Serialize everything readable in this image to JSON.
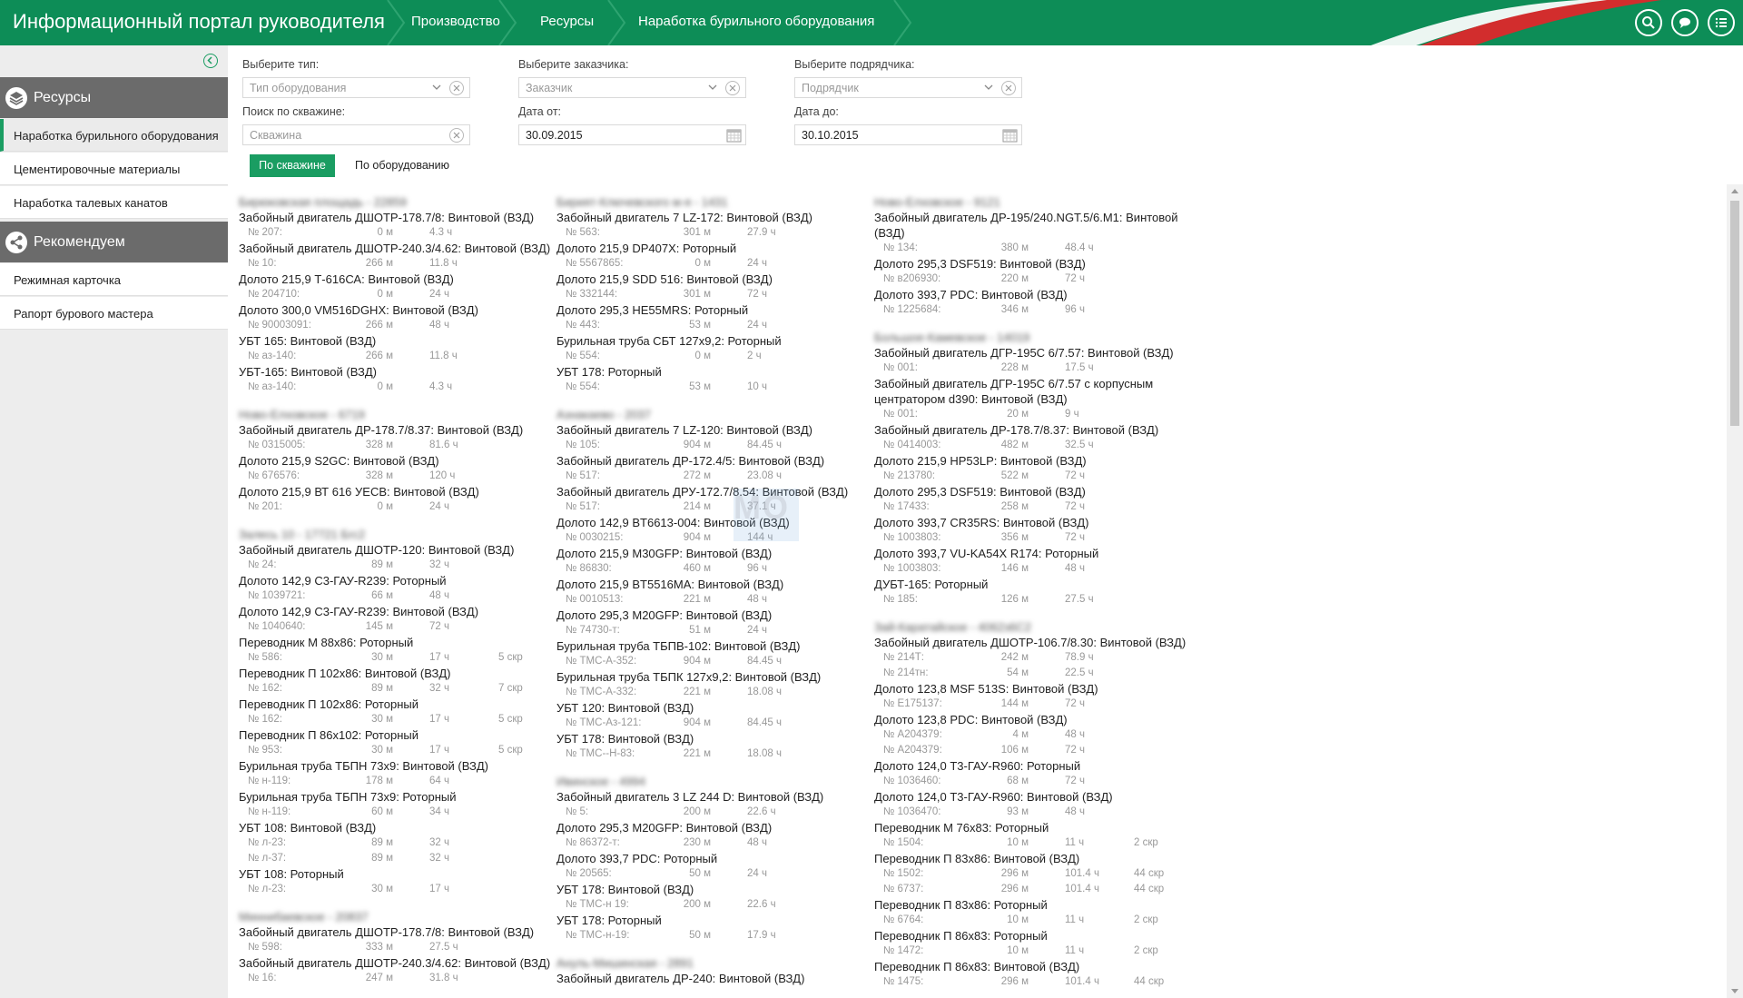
{
  "header": {
    "app_title": "Информационный портал руководителя",
    "breadcrumbs": [
      "Производство",
      "Ресурсы",
      "Наработка бурильного оборудования"
    ],
    "icons": [
      "search-icon",
      "chat-icon",
      "menu-icon"
    ]
  },
  "sidebar": {
    "sections": [
      {
        "title": "Ресурсы",
        "icon": "layers-icon",
        "items": [
          "Наработка бурильного оборудования",
          "Цементировочные материалы",
          "Наработка талевых канатов"
        ]
      },
      {
        "title": "Рекомендуем",
        "icon": "share-icon",
        "items": [
          "Режимная карточка",
          "Рапорт бурового мастера"
        ]
      }
    ],
    "active_item": "Наработка бурильного оборудования"
  },
  "filters": {
    "type_label": "Выберите тип:",
    "type_placeholder": "Тип оборудования",
    "customer_label": "Выберите заказчика:",
    "customer_placeholder": "Заказчик",
    "contractor_label": "Выберите подрядчика:",
    "contractor_placeholder": "Подрядчик",
    "well_search_label": "Поиск по скважине:",
    "well_search_placeholder": "Скважина",
    "date_from_label": "Дата от:",
    "date_from": "30.09.2015",
    "date_to_label": "Дата до:",
    "date_to": "30.10.2015"
  },
  "view_toggle": {
    "by_well": "По скважине",
    "by_equipment": "По оборудованию",
    "active": "По скважине"
  },
  "watermark": "MO",
  "columns": [
    [
      {
        "well": "Бирюковская площадь - 22859",
        "items": [
          {
            "name": "Забойный двигатель ДШОТР-178.7/8: Винтовой (ВЗД)",
            "rows": [
              [
                "№ 207:",
                "0 м",
                "4.3 ч",
                ""
              ]
            ]
          },
          {
            "name": "Забойный двигатель ДШОТР-240.3/4.62: Винтовой (ВЗД)",
            "rows": [
              [
                "№ 10:",
                "266 м",
                "11.8 ч",
                ""
              ]
            ]
          },
          {
            "name": "Долото 215,9 Т-616СА: Винтовой (ВЗД)",
            "rows": [
              [
                "№ 204710:",
                "0 м",
                "24 ч",
                ""
              ]
            ]
          },
          {
            "name": "Долото 300,0 VM516DGHX: Винтовой (ВЗД)",
            "rows": [
              [
                "№ 90003091:",
                "266 м",
                "48 ч",
                ""
              ]
            ]
          },
          {
            "name": "УБТ 165: Винтовой (ВЗД)",
            "rows": [
              [
                "№ аз-140:",
                "266 м",
                "11.8 ч",
                ""
              ]
            ]
          },
          {
            "name": "УБТ-165: Винтовой (ВЗД)",
            "rows": [
              [
                "№ аз-140:",
                "0 м",
                "4.3 ч",
                ""
              ]
            ]
          }
        ]
      },
      {
        "well": "Ново-Елховское - 6719",
        "items": [
          {
            "name": "Забойный двигатель ДР-178.7/8.37: Винтовой (ВЗД)",
            "rows": [
              [
                "№ 0315005:",
                "328 м",
                "81.6 ч",
                ""
              ]
            ]
          },
          {
            "name": "Долото 215,9 S2GC: Винтовой (ВЗД)",
            "rows": [
              [
                "№ 676576:",
                "328 м",
                "120 ч",
                ""
              ]
            ]
          },
          {
            "name": "Долото 215,9 ВТ 616 УЕСВ: Винтовой (ВЗД)",
            "rows": [
              [
                "№ 201:",
                "0 м",
                "24 ч",
                ""
              ]
            ]
          }
        ]
      },
      {
        "well": "Залесь 10 - 17721 Бгс2",
        "items": [
          {
            "name": "Забойный двигатель ДШОТР-120: Винтовой (ВЗД)",
            "rows": [
              [
                "№ 24:",
                "89 м",
                "32 ч",
                ""
              ]
            ]
          },
          {
            "name": "Долото 142,9 С3-ГАУ-R239: Роторный",
            "rows": [
              [
                "№ 1039721:",
                "66 м",
                "48 ч",
                ""
              ]
            ]
          },
          {
            "name": "Долото 142,9 С3-ГАУ-R239: Винтовой (ВЗД)",
            "rows": [
              [
                "№ 1040640:",
                "145 м",
                "72 ч",
                ""
              ]
            ]
          },
          {
            "name": "Переводник М 88х86: Роторный",
            "rows": [
              [
                "№ 586:",
                "30 м",
                "17 ч",
                "5 скр"
              ]
            ]
          },
          {
            "name": "Переводник П 102х86: Винтовой (ВЗД)",
            "rows": [
              [
                "№ 162:",
                "89 м",
                "32 ч",
                "7 скр"
              ]
            ]
          },
          {
            "name": "Переводник П 102х86: Роторный",
            "rows": [
              [
                "№ 162:",
                "30 м",
                "17 ч",
                "5 скр"
              ]
            ]
          },
          {
            "name": "Переводник П 86х102: Роторный",
            "rows": [
              [
                "№ 953:",
                "30 м",
                "17 ч",
                "5 скр"
              ]
            ]
          },
          {
            "name": "Бурильная труба ТБПН 73х9: Винтовой (ВЗД)",
            "rows": [
              [
                "№ н-119:",
                "178 м",
                "64 ч",
                ""
              ]
            ]
          },
          {
            "name": "Бурильная труба ТБПН 73х9: Роторный",
            "rows": [
              [
                "№ н-119:",
                "60 м",
                "34 ч",
                ""
              ]
            ]
          },
          {
            "name": "УБТ 108: Винтовой (ВЗД)",
            "rows": [
              [
                "№ л-23:",
                "89 м",
                "32 ч",
                ""
              ],
              [
                "№ л-37:",
                "89 м",
                "32 ч",
                ""
              ]
            ]
          },
          {
            "name": "УБТ 108: Роторный",
            "rows": [
              [
                "№ л-23:",
                "30 м",
                "17 ч",
                ""
              ]
            ]
          }
        ]
      },
      {
        "well": "Миннибаевское - 20837",
        "items": [
          {
            "name": "Забойный двигатель ДШОТР-178.7/8: Винтовой (ВЗД)",
            "rows": [
              [
                "№ 598:",
                "333 м",
                "27.5 ч",
                ""
              ]
            ]
          },
          {
            "name": "Забойный двигатель ДШОТР-240.3/4.62: Винтовой (ВЗД)",
            "rows": [
              [
                "№ 16:",
                "247 м",
                "31.8 ч",
                ""
              ]
            ]
          }
        ]
      }
    ],
    [
      {
        "well": "Бирият-Ключевского м-я - 1431",
        "items": [
          {
            "name": "Забойный двигатель 7 LZ-172: Винтовой (ВЗД)",
            "rows": [
              [
                "№ 563:",
                "301 м",
                "27.9 ч",
                ""
              ]
            ]
          },
          {
            "name": "Долото 215,9 DP407X: Роторный",
            "rows": [
              [
                "№ 5567865:",
                "0 м",
                "24 ч",
                ""
              ]
            ]
          },
          {
            "name": "Долото 215,9 SDD 516: Винтовой (ВЗД)",
            "rows": [
              [
                "№ 332144:",
                "301 м",
                "72 ч",
                ""
              ]
            ]
          },
          {
            "name": "Долото 295,3 НЕ55MRS: Роторный",
            "rows": [
              [
                "№ 443:",
                "53 м",
                "24 ч",
                ""
              ]
            ]
          },
          {
            "name": "Бурильная труба СБТ 127х9,2: Роторный",
            "rows": [
              [
                "№ 554:",
                "0 м",
                "2 ч",
                ""
              ]
            ]
          },
          {
            "name": "УБТ 178: Роторный",
            "rows": [
              [
                "№ 554:",
                "53 м",
                "10 ч",
                ""
              ]
            ]
          }
        ]
      },
      {
        "well": "Азнакаево - 2037",
        "items": [
          {
            "name": "Забойный двигатель 7 LZ-120: Винтовой (ВЗД)",
            "rows": [
              [
                "№ 105:",
                "904 м",
                "84.45 ч",
                ""
              ]
            ]
          },
          {
            "name": "Забойный двигатель ДР-172.4/5: Винтовой (ВЗД)",
            "rows": [
              [
                "№ 517:",
                "272 м",
                "23.08 ч",
                ""
              ]
            ]
          },
          {
            "name": "Забойный двигатель ДРУ-172.7/8.54: Винтовой (ВЗД)",
            "rows": [
              [
                "№ 517:",
                "214 м",
                "37.1 ч",
                ""
              ]
            ]
          },
          {
            "name": "Долото 142,9 BT6613-004: Винтовой (ВЗД)",
            "rows": [
              [
                "№ 0030215:",
                "904 м",
                "144 ч",
                ""
              ]
            ]
          },
          {
            "name": "Долото 215,9 M30GFP: Винтовой (ВЗД)",
            "rows": [
              [
                "№ 86830:",
                "460 м",
                "96 ч",
                ""
              ]
            ]
          },
          {
            "name": "Долото 215,9 BT5516MA: Винтовой (ВЗД)",
            "rows": [
              [
                "№ 0010513:",
                "221 м",
                "48 ч",
                ""
              ]
            ]
          },
          {
            "name": "Долото 295,3 M20GFP: Винтовой (ВЗД)",
            "rows": [
              [
                "№ 74730-т:",
                "51 м",
                "24 ч",
                ""
              ]
            ]
          },
          {
            "name": "Бурильная труба ТБПВ-102: Винтовой (ВЗД)",
            "rows": [
              [
                "№ ТМС-А-352:",
                "904 м",
                "84.45 ч",
                ""
              ]
            ]
          },
          {
            "name": "Бурильная труба ТБПК 127х9,2: Винтовой (ВЗД)",
            "rows": [
              [
                "№ ТМС-А-332:",
                "221 м",
                "18.08 ч",
                ""
              ]
            ]
          },
          {
            "name": "УБТ 120: Винтовой (ВЗД)",
            "rows": [
              [
                "№ ТМС-Аз-121:",
                "904 м",
                "84.45 ч",
                ""
              ]
            ]
          },
          {
            "name": "УБТ 178: Винтовой (ВЗД)",
            "rows": [
              [
                "№ ТМС--Н-83:",
                "221 м",
                "18.08 ч",
                ""
              ]
            ]
          }
        ]
      },
      {
        "well": "Ивинское - 4994",
        "items": [
          {
            "name": "Забойный двигатель 3 LZ 244 D: Винтовой (ВЗД)",
            "rows": [
              [
                "№ 5:",
                "200 м",
                "22.6 ч",
                ""
              ]
            ]
          },
          {
            "name": "Долото 295,3 M20GFP: Винтовой (ВЗД)",
            "rows": [
              [
                "№ 86372-т:",
                "230 м",
                "48 ч",
                ""
              ]
            ]
          },
          {
            "name": "Долото 393,7 PDC: Роторный",
            "rows": [
              [
                "№ 20565:",
                "50 м",
                "24 ч",
                ""
              ]
            ]
          },
          {
            "name": "УБТ 178: Винтовой (ВЗД)",
            "rows": [
              [
                "№ ТМС-н 19:",
                "200 м",
                "22.6 ч",
                ""
              ]
            ]
          },
          {
            "name": "УБТ 178: Роторный",
            "rows": [
              [
                "№ ТМС-н-19:",
                "50 м",
                "17.9 ч",
                ""
              ]
            ]
          }
        ]
      },
      {
        "well": "Ануль-Мишинская - 2891",
        "items": [
          {
            "name": "Забойный двигатель ДР-240: Винтовой (ВЗД)",
            "rows": []
          }
        ]
      }
    ],
    [
      {
        "well": "Ново-Елховское - 9121",
        "items": [
          {
            "name": "Забойный двигатель ДР-195/240.NGT.5/6.M1: Винтовой (ВЗД)",
            "rows": [
              [
                "№ 134:",
                "380 м",
                "48.4 ч",
                ""
              ]
            ]
          },
          {
            "name": "Долото 295,3 DSF519: Винтовой (ВЗД)",
            "rows": [
              [
                "№ в206930:",
                "220 м",
                "72 ч",
                ""
              ]
            ]
          },
          {
            "name": "Долото 393,7 PDC: Винтовой (ВЗД)",
            "rows": [
              [
                "№ 1225684:",
                "346 м",
                "96 ч",
                ""
              ]
            ]
          }
        ]
      },
      {
        "well": "Большое-Камевское - 14019",
        "items": [
          {
            "name": "Забойный двигатель ДГР-195С 6/7.57: Винтовой (ВЗД)",
            "rows": [
              [
                "№ 001:",
                "228 м",
                "17.5 ч",
                ""
              ]
            ]
          },
          {
            "name": "Забойный двигатель ДГР-195С 6/7.57 с корпусным центратором d390: Винтовой (ВЗД)",
            "rows": [
              [
                "№ 001:",
                "20 м",
                "9 ч",
                ""
              ]
            ]
          },
          {
            "name": "Забойный двигатель ДР-178.7/8.37: Винтовой (ВЗД)",
            "rows": [
              [
                "№ 0414003:",
                "482 м",
                "32.5 ч",
                ""
              ]
            ]
          },
          {
            "name": "Долото 215,9 HP53LP: Винтовой (ВЗД)",
            "rows": [
              [
                "№ 213780:",
                "522 м",
                "72 ч",
                ""
              ]
            ]
          },
          {
            "name": "Долото 295,3 DSF519: Винтовой (ВЗД)",
            "rows": [
              [
                "№ 17433:",
                "258 м",
                "72 ч",
                ""
              ]
            ]
          },
          {
            "name": "Долото 393,7 CR35RS: Винтовой (ВЗД)",
            "rows": [
              [
                "№ 1003803:",
                "356 м",
                "72 ч",
                ""
              ]
            ]
          },
          {
            "name": "Долото 393,7 VU-KA54X R174: Роторный",
            "rows": [
              [
                "№ 1003803:",
                "146 м",
                "48 ч",
                ""
              ]
            ]
          },
          {
            "name": "ДУБТ-165: Роторный",
            "rows": [
              [
                "№ 185:",
                "126 м",
                "27.5 ч",
                ""
              ]
            ]
          }
        ]
      },
      {
        "well": "Зай-Каратайское - 4062з6С2",
        "items": [
          {
            "name": "Забойный двигатель ДШОТР-106.7/8.30: Винтовой (ВЗД)",
            "rows": [
              [
                "№ 214Т:",
                "242 м",
                "78.9 ч",
                ""
              ],
              [
                "№ 214тн:",
                "54 м",
                "22.5 ч",
                ""
              ]
            ]
          },
          {
            "name": "Долото 123,8 MSF 513S: Винтовой (ВЗД)",
            "rows": [
              [
                "№ Е175137:",
                "144 м",
                "72 ч",
                ""
              ]
            ]
          },
          {
            "name": "Долото 123,8 PDC: Винтовой (ВЗД)",
            "rows": [
              [
                "№ А204379:",
                "4 м",
                "48 ч",
                ""
              ],
              [
                "№ А204379:",
                "106 м",
                "72 ч",
                ""
              ]
            ]
          },
          {
            "name": "Долото 124,0 Т3-ГАУ-R960: Роторный",
            "rows": [
              [
                "№ 1036460:",
                "68 м",
                "72 ч",
                ""
              ]
            ]
          },
          {
            "name": "Долото 124,0 Т3-ГАУ-R960: Винтовой (ВЗД)",
            "rows": [
              [
                "№ 1036470:",
                "93 м",
                "48 ч",
                ""
              ]
            ]
          },
          {
            "name": "Переводник М 76х83: Роторный",
            "rows": [
              [
                "№ 1504:",
                "10 м",
                "11 ч",
                "2 скр"
              ]
            ]
          },
          {
            "name": "Переводник П 83х86: Винтовой (ВЗД)",
            "rows": [
              [
                "№ 1502:",
                "296 м",
                "101.4 ч",
                "44 скр"
              ],
              [
                "№ 6737:",
                "296 м",
                "101.4 ч",
                "44 скр"
              ]
            ]
          },
          {
            "name": "Переводник П 83х86: Роторный",
            "rows": [
              [
                "№ 6764:",
                "10 м",
                "11 ч",
                "2 скр"
              ]
            ]
          },
          {
            "name": "Переводник П 86х83: Роторный",
            "rows": [
              [
                "№ 1472:",
                "10 м",
                "11 ч",
                "2 скр"
              ]
            ]
          },
          {
            "name": "Переводник П 86х83: Винтовой (ВЗД)",
            "rows": [
              [
                "№ 1475:",
                "296 м",
                "101.4 ч",
                "44 скр"
              ]
            ]
          }
        ]
      }
    ]
  ]
}
